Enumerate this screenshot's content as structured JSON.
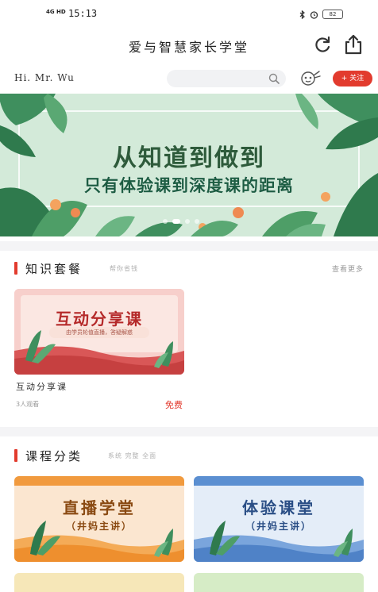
{
  "status_bar": {
    "network": "4G HD",
    "time": "15:13",
    "battery": "82"
  },
  "header": {
    "title": "爱与智慧家长学堂",
    "refresh_icon": "refresh-icon",
    "share_icon": "share-icon"
  },
  "user_row": {
    "greeting": "Hi.  Mr. Wu",
    "search_placeholder": "",
    "follow_label": "+ 关注"
  },
  "banner": {
    "heading": "从知道到做到",
    "subheading": "只有体验课到深度课的距离",
    "slide_count": 4,
    "active_slide": 2
  },
  "knowledge_section": {
    "title": "知识套餐",
    "hint": "帮你省钱",
    "more": "查看更多",
    "card": {
      "thumb_title": "互动分享课",
      "thumb_tag": "由学员轮值直播，答疑解惑",
      "name": "互动分享课",
      "viewers": "3人观看",
      "price": "免费"
    }
  },
  "category_section": {
    "title": "课程分类",
    "hint": "系统  完整  全面",
    "tiles": [
      {
        "title": "直播学堂",
        "subtitle": "（井妈主讲）"
      },
      {
        "title": "体验课堂",
        "subtitle": "（井妈主讲）"
      }
    ]
  },
  "colors": {
    "accent": "#e23b2e",
    "banner_bg": "#cfe7da",
    "tile_orange": "#f19a3e",
    "tile_blue": "#5b8fd1"
  }
}
